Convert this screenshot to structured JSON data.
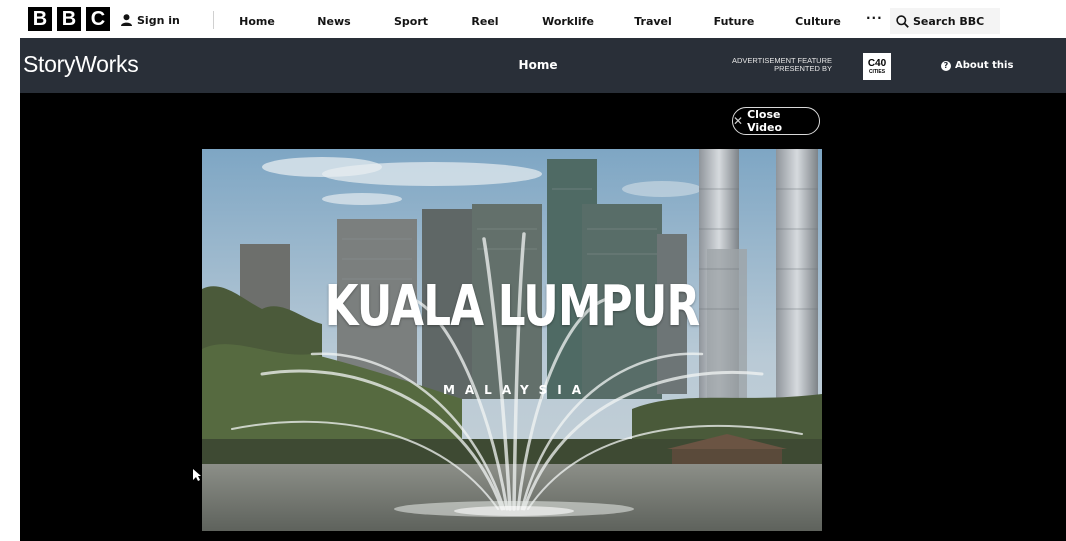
{
  "bbc": {
    "logo_letters": [
      "B",
      "B",
      "C"
    ],
    "sign_in": "Sign in",
    "nav": [
      "Home",
      "News",
      "Sport",
      "Reel",
      "Worklife",
      "Travel",
      "Future",
      "Culture"
    ],
    "more": "···",
    "search": "Search BBC"
  },
  "storyworks": {
    "brand": "StoryWorks",
    "home": "Home",
    "ad_line1": "ADVERTISEMENT FEATURE",
    "ad_line2": "PRESENTED BY",
    "sponsor_line1": "C40",
    "sponsor_line2": "CITIES",
    "about": "About this"
  },
  "video": {
    "close_label": "Close Video",
    "title": "KUALA LUMPUR",
    "subtitle": "MALAYSIA"
  },
  "colors": {
    "storyworks_bar": "#292f38",
    "stage": "#000000"
  },
  "icons": [
    "user-icon",
    "search-icon",
    "question-icon",
    "close-icon"
  ]
}
